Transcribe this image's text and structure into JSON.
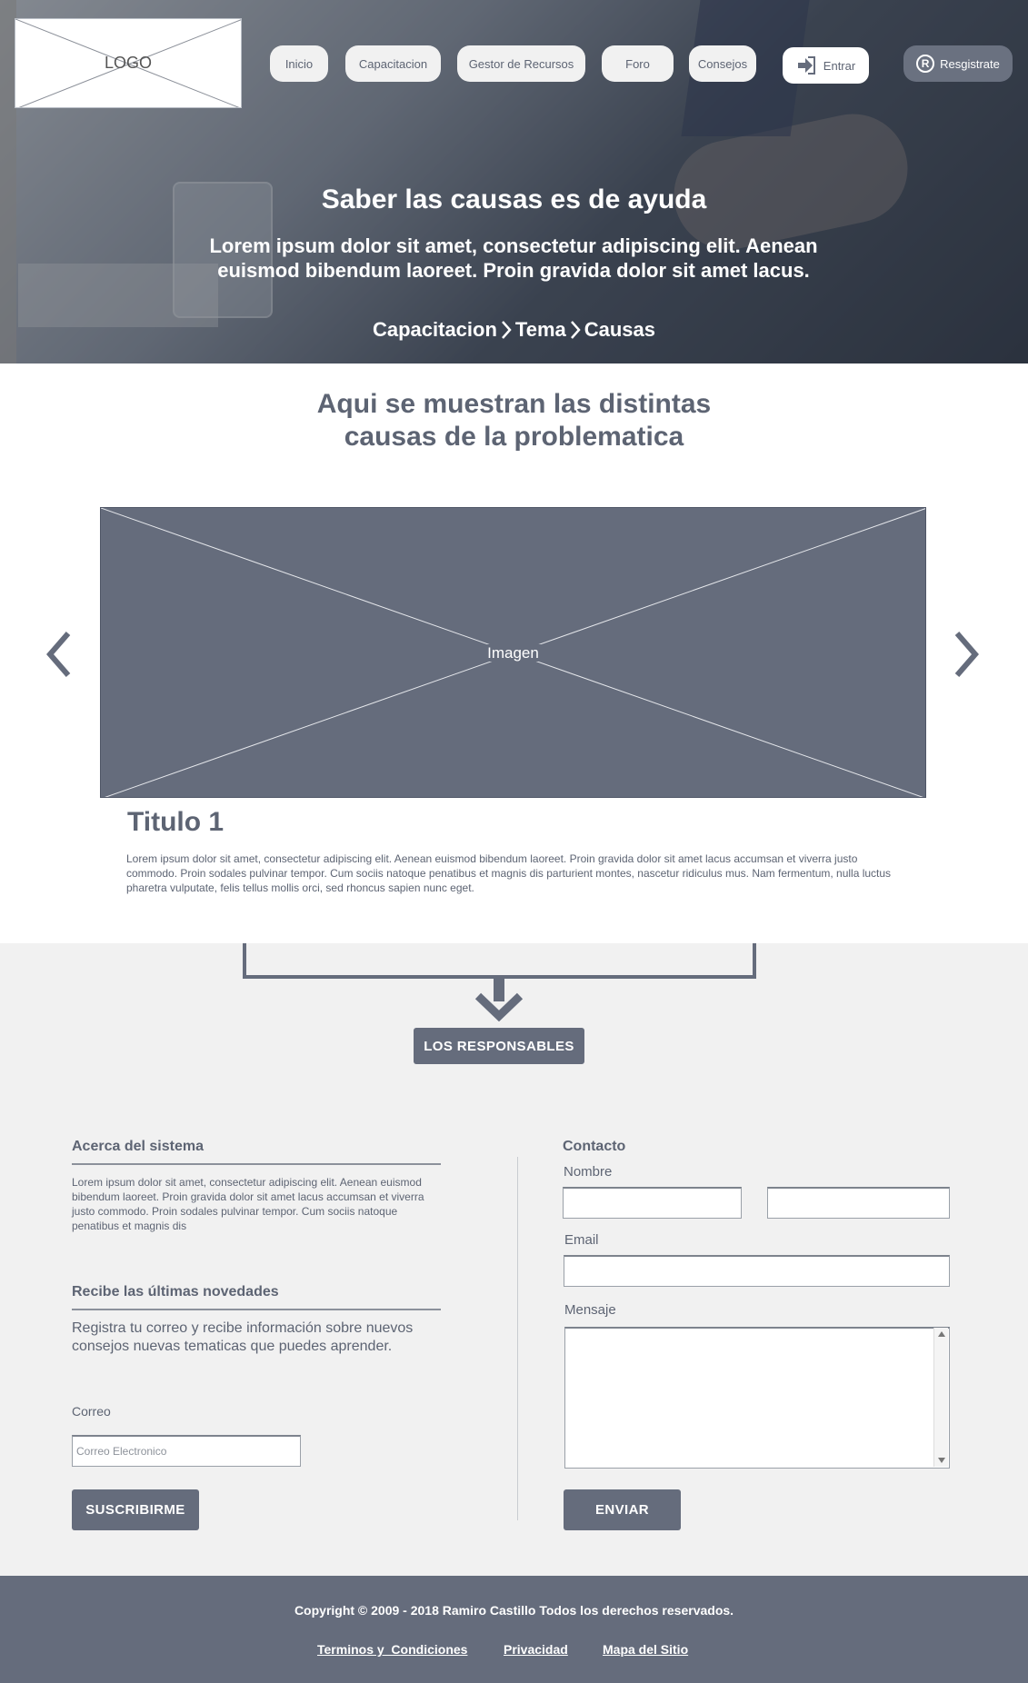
{
  "header": {
    "logo_text": "LOGO",
    "nav": [
      "Inicio",
      "Capacitacion",
      "Gestor de Recursos",
      "Foro",
      "Consejos"
    ],
    "login_label": "Entrar",
    "register_label": "Resgistrate"
  },
  "hero": {
    "title": "Saber las causas es de ayuda",
    "subtitle": "Lorem ipsum dolor sit amet, consectetur adipiscing elit. Aenean euismod bibendum laoreet. Proin gravida dolor sit amet lacus.",
    "breadcrumb": [
      "Capacitacion",
      "Tema",
      "Causas"
    ]
  },
  "main": {
    "heading_line1": "Aqui se muestran las distintas",
    "heading_line2": "causas de la problematica",
    "slide_image_label": "Imagen",
    "slide_title": "Titulo 1",
    "slide_text": "Lorem ipsum dolor sit amet, consectetur adipiscing elit. Aenean euismod bibendum laoreet. Proin gravida dolor sit amet lacus accumsan et viverra justo commodo. Proin sodales pulvinar tempor. Cum sociis natoque penatibus et magnis dis parturient montes, nascetur ridiculus mus. Nam fermentum, nulla luctus pharetra vulputate, felis tellus mollis orci, sed rhoncus sapien nunc eget.",
    "responsables_button": "LOS RESPONSABLES"
  },
  "about": {
    "title": "Acerca del sistema",
    "text": "Lorem ipsum dolor sit amet, consectetur adipiscing elit. Aenean euismod bibendum laoreet. Proin gravida dolor sit amet lacus accumsan et viverra justo commodo. Proin sodales pulvinar tempor. Cum sociis natoque penatibus et magnis dis"
  },
  "newsletter": {
    "title": "Recibe las últimas novedades",
    "text": "Registra tu correo y recibe información sobre nuevos consejos nuevas tematicas que puedes aprender.",
    "email_label": "Correo",
    "email_placeholder": "Correo Electronico",
    "subscribe_button": "SUSCRIBIRME"
  },
  "contact": {
    "title": "Contacto",
    "name_label": "Nombre",
    "email_label": "Email",
    "message_label": "Mensaje",
    "send_button": "ENVIAR"
  },
  "footer": {
    "copyright": "Copyright © 2009 - 2018 Ramiro Castillo Todos los derechos reservados.",
    "links": [
      "Terminos y  Condiciones",
      "Privacidad",
      "Mapa del Sitio"
    ]
  },
  "colors": {
    "primary": "#656c7c",
    "text": "#5d6473",
    "light_bg": "#f1f1f1"
  }
}
